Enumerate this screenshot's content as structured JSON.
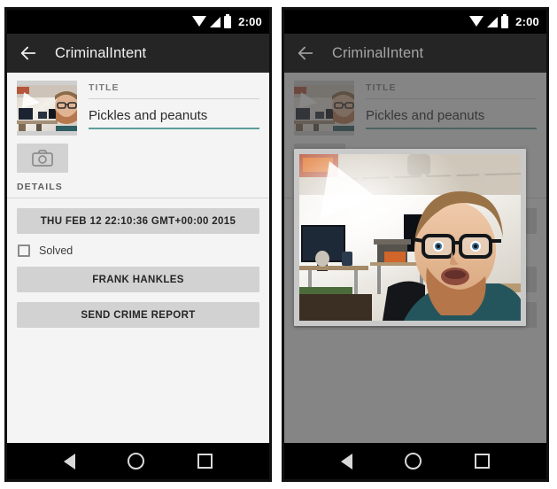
{
  "screens": [
    {
      "id": "crime-detail",
      "statusbar": {
        "time": "2:00",
        "icons": [
          "wifi-icon",
          "signal-icon",
          "battery-icon"
        ]
      },
      "toolbar": {
        "back_icon": "back-arrow-icon",
        "title": "CriminalIntent"
      },
      "form": {
        "thumbnail_alt": "crime-photo-thumbnail",
        "title_label": "TITLE",
        "title_value": "Pickles and peanuts",
        "camera_button_icon": "camera-icon",
        "details_label": "DETAILS",
        "date_button": "THU FEB 12 22:10:36 GMT+00:00 2015",
        "solved_checkbox_label": "Solved",
        "solved_checked": false,
        "suspect_button": "FRANK HANKLES",
        "report_button": "SEND CRIME REPORT"
      },
      "navbar": {
        "back": "nav-back-icon",
        "home": "nav-home-icon",
        "recents": "nav-recents-icon"
      },
      "dialog_open": false
    },
    {
      "id": "crime-detail-photo-dialog",
      "statusbar": {
        "time": "2:00",
        "icons": [
          "wifi-icon",
          "signal-icon",
          "battery-icon"
        ]
      },
      "toolbar": {
        "back_icon": "back-arrow-icon",
        "title": "CriminalIntent"
      },
      "form": {
        "thumbnail_alt": "crime-photo-thumbnail",
        "title_label": "TITLE",
        "title_value": "Pickles and peanuts",
        "camera_button_icon": "camera-icon",
        "details_label": "DETAILS",
        "date_button": "THU FEB 12 22:10:36 GMT+00:00 2015",
        "solved_checkbox_label": "Solved",
        "solved_checked": false,
        "suspect_button": "FRANK HANKLES",
        "report_button": "SEND CRIME REPORT"
      },
      "navbar": {
        "back": "nav-back-icon",
        "home": "nav-home-icon",
        "recents": "nav-recents-icon"
      },
      "dialog_open": true,
      "dialog": {
        "photo_alt": "crime-photo-fullsize"
      }
    }
  ],
  "colors": {
    "status_bar": "#000000",
    "toolbar": "#252525",
    "content_background": "#f4f4f4",
    "button_gray": "#d2d2d2",
    "title_underline_teal": "#5d9e99",
    "scrim": "rgba(64,64,64,0.62)"
  }
}
